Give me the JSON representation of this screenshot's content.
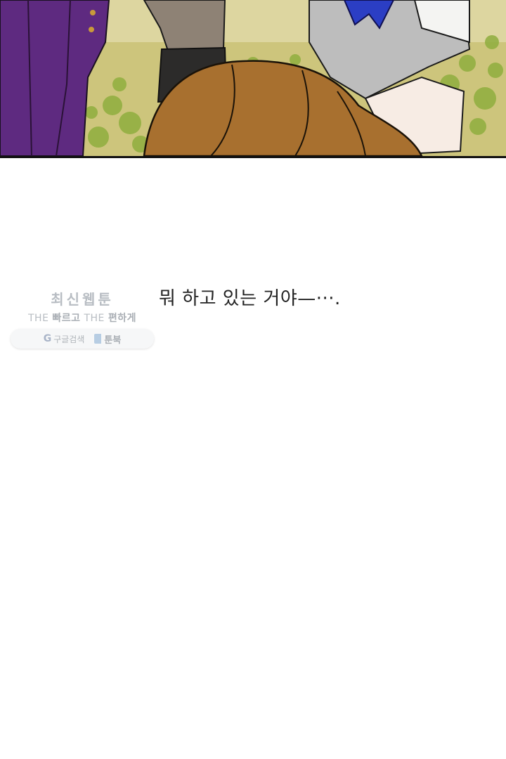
{
  "panel": {
    "icon": "comic-panel-illustration"
  },
  "dialogue": {
    "text": "뭐 하고 있는 거야—···."
  },
  "watermark": {
    "title": "최신웹툰",
    "subtitle_prefix": "THE ",
    "subtitle_fast": "빠르고",
    "subtitle_mid": " THE ",
    "subtitle_easy": "편하게",
    "google_icon": "G",
    "google_label": "구글검색",
    "book_icon": "toonbook-icon",
    "toon_label": "툰북"
  }
}
